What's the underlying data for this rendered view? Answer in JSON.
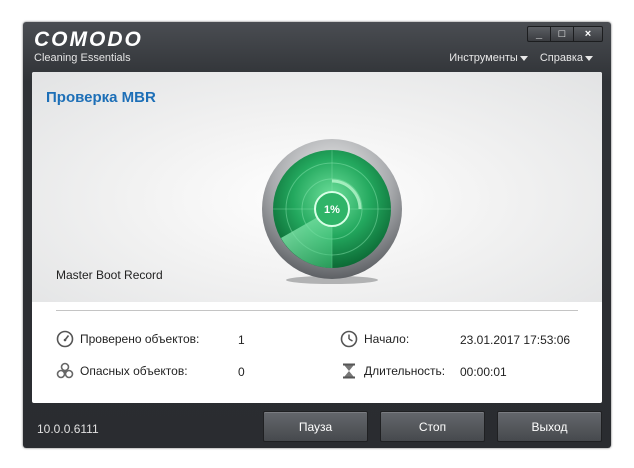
{
  "app": {
    "logo": "COMODO",
    "subtitle": "Cleaning Essentials"
  },
  "window_controls": {
    "minimize": "_",
    "maximize": "□",
    "close": "×"
  },
  "menu": {
    "tools": "Инструменты",
    "help": "Справка"
  },
  "scan": {
    "title": "Проверка MBR",
    "progress_label": "1%",
    "progress_value": 1,
    "current_target": "Master Boot Record"
  },
  "stats": {
    "checked_label": "Проверено объектов:",
    "checked_value": "1",
    "dangerous_label": "Опасных объектов:",
    "dangerous_value": "0",
    "start_label": "Начало:",
    "start_value": "23.01.2017 17:53:06",
    "duration_label": "Длительность:",
    "duration_value": "00:00:01"
  },
  "footer": {
    "version": "10.0.0.6111",
    "pause": "Пауза",
    "stop": "Стоп",
    "exit": "Выход"
  },
  "colors": {
    "title_blue": "#1d6fb7",
    "radar_green": "#1fa35a",
    "chrome_dark": "#2f3236"
  }
}
